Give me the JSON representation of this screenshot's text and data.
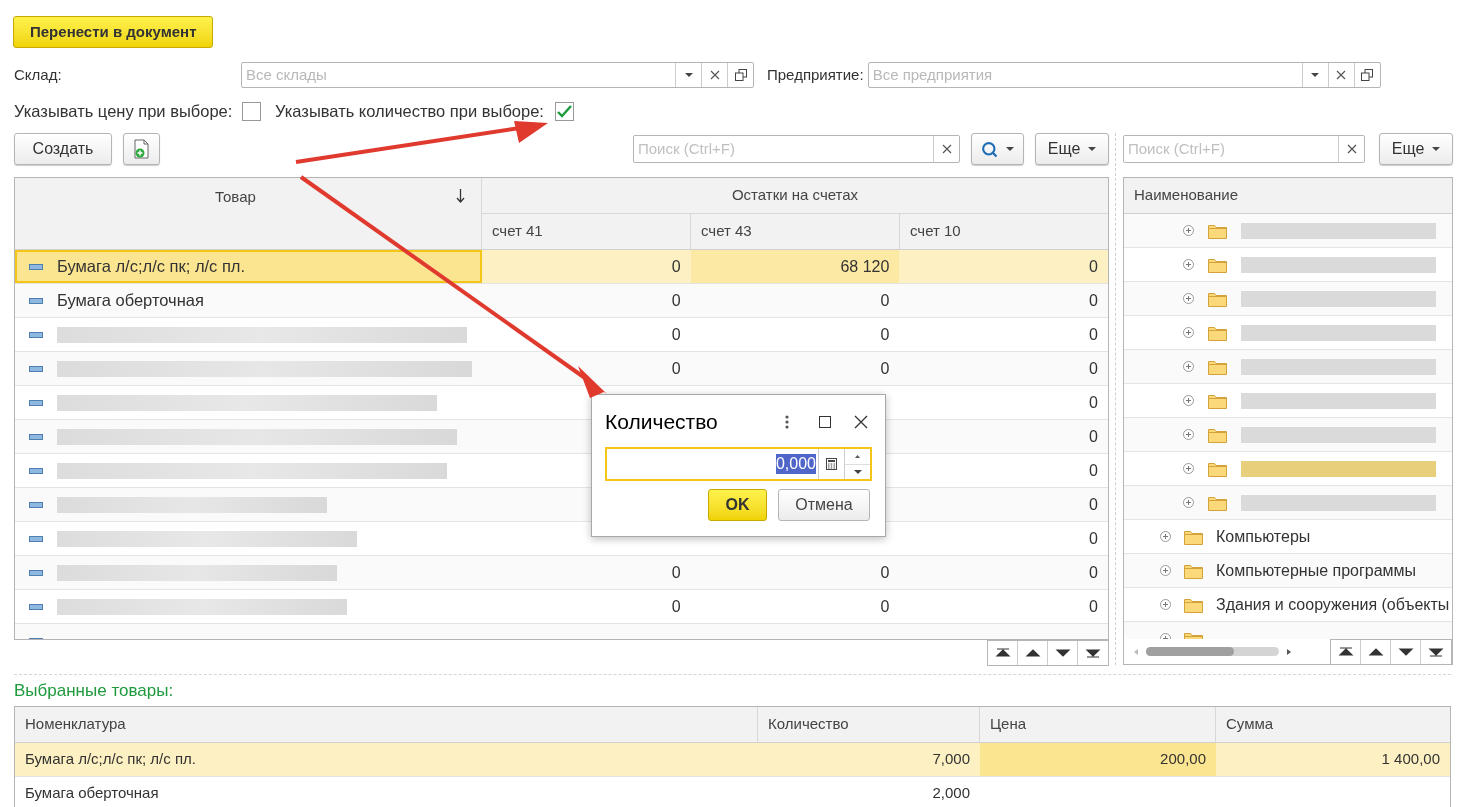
{
  "transfer_button": "Перенести в документ",
  "warehouse": {
    "label": "Склад:",
    "placeholder": "Все склады"
  },
  "enterprise": {
    "label": "Предприятие:",
    "placeholder": "Все предприятия"
  },
  "options": [
    {
      "label": "Указывать цену при выборе:",
      "checked": false
    },
    {
      "label": "Указывать количество при выборе:",
      "checked": true
    }
  ],
  "toolbar": {
    "create": "Создать",
    "search_placeholder": "Поиск (Ctrl+F)",
    "more": "Еще"
  },
  "goods_table": {
    "product_column": "Товар",
    "group_column": "Остатки на счетах",
    "account_columns": [
      "счет 41",
      "счет 43",
      "счет 10"
    ],
    "rows": [
      {
        "kind": "text",
        "name": "Бумага л/с;л/с пк; л/с пл.",
        "values": {
          "account_41": "0",
          "account_43": "68 120",
          "account_10": "0"
        },
        "selected": true
      },
      {
        "kind": "text",
        "name": "Бумага оберточная",
        "values": {
          "account_41": "0",
          "account_43": "0",
          "account_10": "0"
        },
        "selected": false
      },
      {
        "kind": "blurred",
        "values": {
          "account_41": "0",
          "account_43": "0",
          "account_10": "0"
        },
        "selected": false
      },
      {
        "kind": "blurred",
        "values": {
          "account_41": "0",
          "account_43": "0",
          "account_10": "0"
        },
        "selected": false
      },
      {
        "kind": "blurred",
        "values": {
          "account_10": "0"
        },
        "selected": false
      },
      {
        "kind": "blurred",
        "values": {
          "account_10": "0"
        },
        "selected": false
      },
      {
        "kind": "blurred",
        "values": {
          "account_10": "0"
        },
        "selected": false
      },
      {
        "kind": "blurred",
        "values": {
          "account_10": "0"
        },
        "selected": false
      },
      {
        "kind": "blurred",
        "values": {
          "account_10": "0"
        },
        "selected": false
      },
      {
        "kind": "blurred",
        "values": {
          "account_41": "0",
          "account_43": "0",
          "account_10": "0"
        },
        "selected": false
      },
      {
        "kind": "blurred",
        "values": {
          "account_41": "0",
          "account_43": "0",
          "account_10": "0"
        },
        "selected": false
      },
      {
        "kind": "cut",
        "values": {},
        "selected": false
      }
    ]
  },
  "tree": {
    "search_placeholder": "Поиск (Ctrl+F)",
    "more": "Еще",
    "column": "Наименование",
    "child_rows": [
      {
        "kind": "blurred",
        "selected": false
      },
      {
        "kind": "blurred",
        "selected": false
      },
      {
        "kind": "blurred",
        "selected": false
      },
      {
        "kind": "blurred",
        "selected": false
      },
      {
        "kind": "blurred",
        "selected": false
      },
      {
        "kind": "blurred",
        "selected": false
      },
      {
        "kind": "blurred",
        "selected": false
      },
      {
        "kind": "blurred",
        "selected": true
      },
      {
        "kind": "blurred",
        "selected": false
      }
    ],
    "rows": [
      {
        "kind": "text",
        "name": "Компьютеры",
        "selected": false
      },
      {
        "kind": "text",
        "name": "Компьютерные программы",
        "selected": false
      },
      {
        "kind": "text",
        "name": "Здания и сооружения (объекты",
        "selected": false
      },
      {
        "kind": "cut",
        "selected": false
      }
    ]
  },
  "selected_title": "Выбранные товары:",
  "selected_table": {
    "columns": [
      "Номенклатура",
      "Количество",
      "Цена",
      "Сумма"
    ],
    "rows": [
      {
        "name": "Бумага л/с;л/с пк; л/с пл.",
        "quantity": "7,000",
        "price": "200,00",
        "sum": "1 400,00",
        "selected": true
      },
      {
        "name": "Бумага оберточная",
        "quantity": "2,000",
        "selected": false
      }
    ]
  },
  "dialog": {
    "title": "Количество",
    "value": "0,000",
    "ok": "OK",
    "cancel": "Отмена"
  }
}
